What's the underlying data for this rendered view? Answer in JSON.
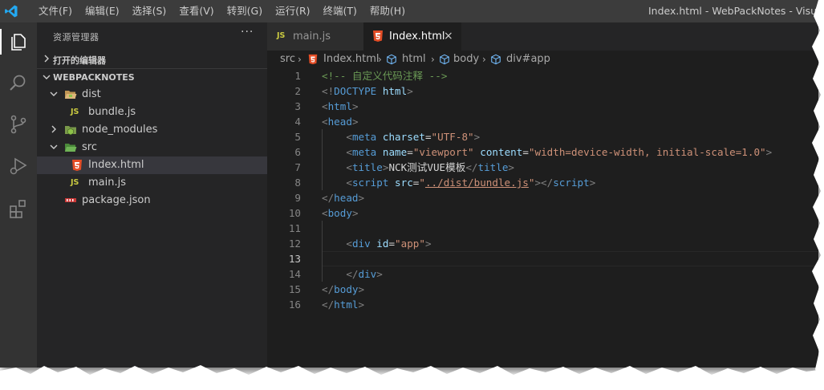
{
  "titlebar": {
    "menu": [
      "文件(F)",
      "编辑(E)",
      "选择(S)",
      "查看(V)",
      "转到(G)",
      "运行(R)",
      "终端(T)",
      "帮助(H)"
    ],
    "title": "Index.html - WebPackNotes - Visual"
  },
  "activity_icons": [
    "explorer-icon",
    "search-icon",
    "source-control-icon",
    "run-debug-icon",
    "extensions-icon"
  ],
  "sidebar": {
    "title": "资源管理器",
    "more": "···",
    "open_editors": "打开的编辑器",
    "project": "WEBPACKNOTES",
    "tree": [
      {
        "label": "dist",
        "type": "folder",
        "expanded": true
      },
      {
        "label": "bundle.js",
        "type": "js"
      },
      {
        "label": "node_modules",
        "type": "folder",
        "expanded": false
      },
      {
        "label": "src",
        "type": "folder",
        "expanded": true
      },
      {
        "label": "Index.html",
        "type": "html",
        "selected": true
      },
      {
        "label": "main.js",
        "type": "js"
      },
      {
        "label": "package.json",
        "type": "json"
      }
    ],
    "js_badge": "JS"
  },
  "tabs": [
    {
      "label": "main.js",
      "icon": "js-icon",
      "active": false
    },
    {
      "label": "Index.html",
      "icon": "html5-icon",
      "active": true,
      "close": "×"
    }
  ],
  "breadcrumbs": [
    "src",
    "Index.html",
    "html",
    "body",
    "div#app"
  ],
  "editor": {
    "current_line": 13,
    "lines": [
      {
        "n": "1",
        "tokens": [
          [
            "cmt",
            "<!-- 自定义代码注释 -->"
          ]
        ]
      },
      {
        "n": "2",
        "tokens": [
          [
            "punct",
            "<!"
          ],
          [
            "tag",
            "DOCTYPE"
          ],
          [
            "text",
            " "
          ],
          [
            "attr",
            "html"
          ],
          [
            "punct",
            ">"
          ]
        ]
      },
      {
        "n": "3",
        "tokens": [
          [
            "punct",
            "<"
          ],
          [
            "tag",
            "html"
          ],
          [
            "punct",
            ">"
          ]
        ]
      },
      {
        "n": "4",
        "tokens": [
          [
            "punct",
            "<"
          ],
          [
            "tag",
            "head"
          ],
          [
            "punct",
            ">"
          ]
        ]
      },
      {
        "n": "5",
        "tokens": [
          [
            "text",
            "    "
          ],
          [
            "punct",
            "<"
          ],
          [
            "tag",
            "meta"
          ],
          [
            "text",
            " "
          ],
          [
            "attr",
            "charset"
          ],
          [
            "text",
            "="
          ],
          [
            "str",
            "\"UTF-8\""
          ],
          [
            "punct",
            ">"
          ]
        ]
      },
      {
        "n": "6",
        "tokens": [
          [
            "text",
            "    "
          ],
          [
            "punct",
            "<"
          ],
          [
            "tag",
            "meta"
          ],
          [
            "text",
            " "
          ],
          [
            "attr",
            "name"
          ],
          [
            "text",
            "="
          ],
          [
            "str",
            "\"viewport\""
          ],
          [
            "text",
            " "
          ],
          [
            "attr",
            "content"
          ],
          [
            "text",
            "="
          ],
          [
            "str",
            "\"width=device-width, initial-scale=1.0\""
          ],
          [
            "punct",
            ">"
          ]
        ]
      },
      {
        "n": "7",
        "tokens": [
          [
            "text",
            "    "
          ],
          [
            "punct",
            "<"
          ],
          [
            "tag",
            "title"
          ],
          [
            "punct",
            ">"
          ],
          [
            "text",
            "NCK测试VUE模板"
          ],
          [
            "punct",
            "</"
          ],
          [
            "tag",
            "title"
          ],
          [
            "punct",
            ">"
          ]
        ]
      },
      {
        "n": "8",
        "tokens": [
          [
            "text",
            "    "
          ],
          [
            "punct",
            "<"
          ],
          [
            "tag",
            "script"
          ],
          [
            "text",
            " "
          ],
          [
            "attr",
            "src"
          ],
          [
            "text",
            "="
          ],
          [
            "str",
            "\""
          ],
          [
            "link",
            "../dist/bundle.js"
          ],
          [
            "str",
            "\""
          ],
          [
            "punct",
            "></"
          ],
          [
            "tag",
            "script"
          ],
          [
            "punct",
            ">"
          ]
        ]
      },
      {
        "n": "9",
        "tokens": [
          [
            "punct",
            "</"
          ],
          [
            "tag",
            "head"
          ],
          [
            "punct",
            ">"
          ]
        ]
      },
      {
        "n": "10",
        "tokens": [
          [
            "punct",
            "<"
          ],
          [
            "tag",
            "body"
          ],
          [
            "punct",
            ">"
          ]
        ]
      },
      {
        "n": "11",
        "tokens": []
      },
      {
        "n": "12",
        "tokens": [
          [
            "text",
            "    "
          ],
          [
            "punct",
            "<"
          ],
          [
            "tag",
            "div"
          ],
          [
            "text",
            " "
          ],
          [
            "attr",
            "id"
          ],
          [
            "text",
            "="
          ],
          [
            "str",
            "\"app\""
          ],
          [
            "punct",
            ">"
          ]
        ]
      },
      {
        "n": "13",
        "tokens": []
      },
      {
        "n": "14",
        "tokens": [
          [
            "text",
            "    "
          ],
          [
            "punct",
            "</"
          ],
          [
            "tag",
            "div"
          ],
          [
            "punct",
            ">"
          ]
        ]
      },
      {
        "n": "15",
        "tokens": [
          [
            "punct",
            "</"
          ],
          [
            "tag",
            "body"
          ],
          [
            "punct",
            ">"
          ]
        ]
      },
      {
        "n": "16",
        "tokens": [
          [
            "punct",
            "</"
          ],
          [
            "tag",
            "html"
          ],
          [
            "punct",
            ">"
          ]
        ]
      }
    ]
  },
  "colors": {
    "tag": "#569cd6",
    "attr": "#9cdcfe",
    "string": "#ce9178",
    "comment": "#6a9955",
    "html_icon": "#e44d26",
    "js_icon": "#cbcb41",
    "folder": "#dcb67a"
  }
}
